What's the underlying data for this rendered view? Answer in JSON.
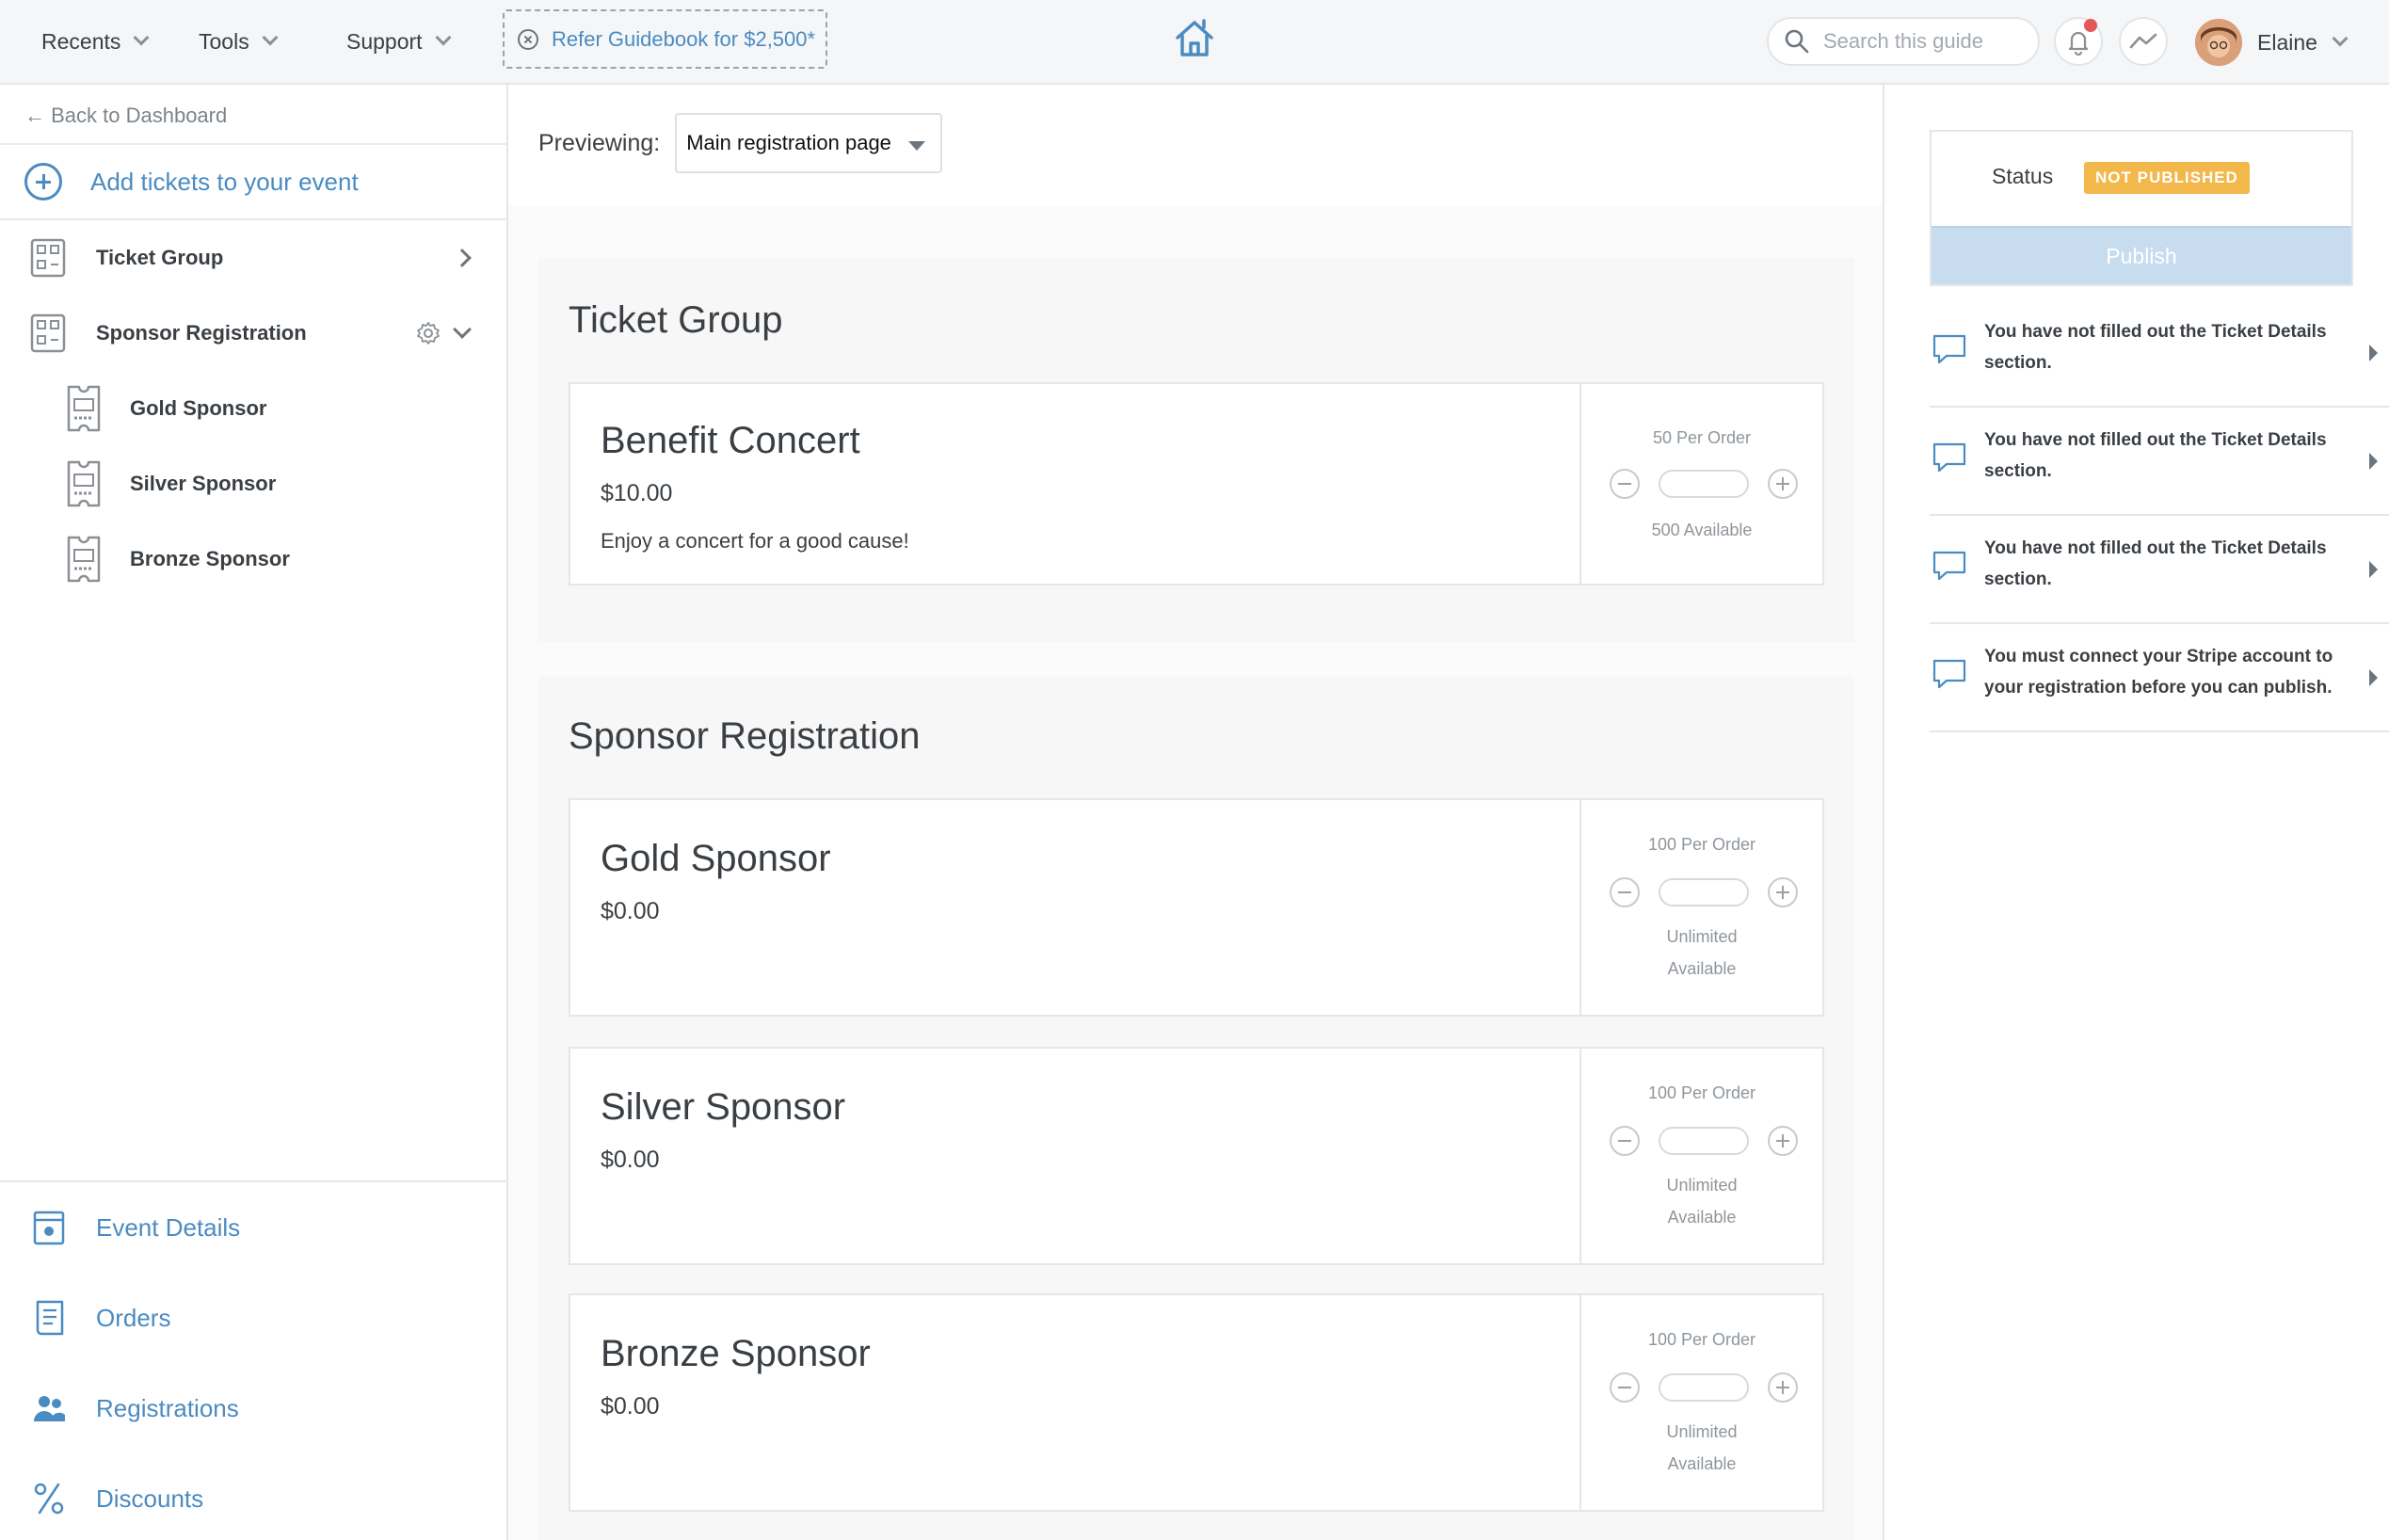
{
  "topbar": {
    "menus": [
      {
        "label": "Recents"
      },
      {
        "label": "Tools"
      },
      {
        "label": "Support"
      }
    ],
    "refer_label": "Refer Guidebook for $2,500*",
    "search_placeholder": "Search this guide",
    "user_name": "Elaine"
  },
  "sidebar": {
    "back_label": "← Back to Dashboard",
    "add_tickets_label": "Add tickets to your event",
    "groups": [
      {
        "label": "Ticket Group"
      },
      {
        "label": "Sponsor Registration"
      }
    ],
    "tickets": [
      {
        "label": "Gold Sponsor"
      },
      {
        "label": "Silver Sponsor"
      },
      {
        "label": "Bronze Sponsor"
      }
    ],
    "bottom_nav": [
      {
        "label": "Event Details",
        "icon": "event-details-icon"
      },
      {
        "label": "Orders",
        "icon": "orders-icon"
      },
      {
        "label": "Registrations",
        "icon": "registrations-icon"
      },
      {
        "label": "Discounts",
        "icon": "percent-icon"
      }
    ]
  },
  "main": {
    "previewing_label": "Previewing:",
    "preview_selected": "Main registration page",
    "sections": [
      {
        "title": "Ticket Group",
        "tickets": [
          {
            "name": "Benefit Concert",
            "price": "$10.00",
            "description": "Enjoy a concert for a good cause!",
            "per_order": "50 Per Order",
            "available_1": "500 Available",
            "available_2": ""
          }
        ]
      },
      {
        "title": "Sponsor Registration",
        "tickets": [
          {
            "name": "Gold Sponsor",
            "price": "$0.00",
            "description": "",
            "per_order": "100 Per Order",
            "available_1": "Unlimited",
            "available_2": "Available"
          },
          {
            "name": "Silver Sponsor",
            "price": "$0.00",
            "description": "",
            "per_order": "100 Per Order",
            "available_1": "Unlimited",
            "available_2": "Available"
          },
          {
            "name": "Bronze Sponsor",
            "price": "$0.00",
            "description": "",
            "per_order": "100 Per Order",
            "available_1": "Unlimited",
            "available_2": "Available"
          }
        ]
      }
    ]
  },
  "right": {
    "status_label": "Status",
    "status_badge": "NOT PUBLISHED",
    "publish_label": "Publish",
    "messages": [
      {
        "text": "You have not filled out the Ticket Details section."
      },
      {
        "text": "You have not filled out the Ticket Details section."
      },
      {
        "text": "You have not filled out the Ticket Details section."
      },
      {
        "text": "You must connect your Stripe account to your registration before you can publish."
      }
    ]
  },
  "colors": {
    "accent": "#4a8bc2",
    "badge": "#f2b84b",
    "notification": "#e45858"
  }
}
